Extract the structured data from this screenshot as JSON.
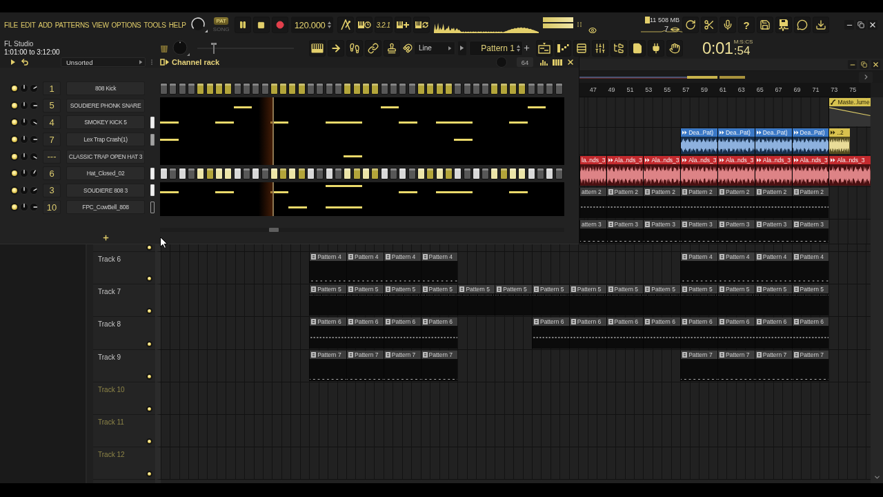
{
  "toolbar": {
    "menu": [
      "FILE",
      "EDIT",
      "ADD",
      "PATTERNS",
      "VIEW",
      "OPTIONS",
      "TOOLS",
      "HELP"
    ],
    "song_mode": [
      {
        "label": "PAT",
        "selected": true
      },
      {
        "label": "SONG",
        "selected": false
      }
    ],
    "playing": true,
    "tempo": "120.000",
    "countdown": "3.2.1",
    "output_meter": [
      {
        "level": 1
      },
      {
        "level": 1
      }
    ],
    "cpu": "11",
    "memory": "508 MB",
    "polyphony": "7",
    "help": "?",
    "title": "FL Studio",
    "hint": "1:01:00 to 3:12:00",
    "pitch": {
      "level": 0.15
    },
    "snap": "Line",
    "pattern": "Pattern 1",
    "time": "0:01",
    "time_fraction": ":54",
    "time_format": "M:S:CS"
  },
  "channel_rack": {
    "filter": "Unsorted",
    "title": "Channel rack",
    "steps_field": "64",
    "playhead": {
      "level": 0.28
    },
    "channels": [
      {
        "number": "1",
        "name": "808 Kick",
        "enabled": true,
        "pan": {
          "kind": "center"
        },
        "volume": {
          "kind": "two"
        },
        "kind": "steps",
        "steps": [
          false,
          false,
          false,
          false,
          false,
          false,
          false,
          false,
          false,
          false,
          false,
          false,
          false,
          false,
          false,
          false,
          false,
          false,
          false,
          false,
          false,
          false,
          false,
          false,
          false,
          false,
          false,
          false,
          false,
          false,
          false,
          false,
          false,
          false,
          false,
          false,
          false,
          false,
          false,
          false,
          false,
          false,
          false,
          false
        ]
      },
      {
        "number": "5",
        "name": "SOUDIERE PHONK SNARE",
        "enabled": true,
        "pan": {
          "kind": "center"
        },
        "volume": {
          "kind": "three"
        },
        "kind": "roll",
        "notes": [
          {
            "kind": "rest"
          },
          {
            "kind": "rest"
          },
          {
            "kind": "rest"
          },
          {
            "kind": "rest"
          },
          {
            "kind": "rest"
          },
          {
            "kind": "rest"
          },
          {
            "kind": "rest"
          },
          {
            "kind": "rest"
          },
          {
            "kind": "low"
          },
          {
            "kind": "low"
          },
          {
            "kind": "rest"
          },
          {
            "kind": "rest"
          },
          {
            "kind": "rest"
          },
          {
            "kind": "rest"
          },
          {
            "kind": "rest"
          },
          {
            "kind": "rest"
          },
          {
            "kind": "rest"
          },
          {
            "kind": "rest"
          },
          {
            "kind": "rest"
          },
          {
            "kind": "rest"
          },
          {
            "kind": "rest"
          },
          {
            "kind": "rest"
          },
          {
            "kind": "rest"
          },
          {
            "kind": "rest"
          },
          {
            "kind": "low"
          },
          {
            "kind": "low"
          },
          {
            "kind": "rest"
          },
          {
            "kind": "rest"
          },
          {
            "kind": "rest"
          },
          {
            "kind": "rest"
          },
          {
            "kind": "rest"
          },
          {
            "kind": "rest"
          },
          {
            "kind": "rest"
          },
          {
            "kind": "rest"
          },
          {
            "kind": "rest"
          },
          {
            "kind": "rest"
          },
          {
            "kind": "rest"
          },
          {
            "kind": "rest"
          },
          {
            "kind": "rest"
          },
          {
            "kind": "rest"
          },
          {
            "kind": "low"
          },
          {
            "kind": "low"
          },
          {
            "kind": "rest"
          },
          {
            "kind": "rest"
          }
        ]
      },
      {
        "number": "4",
        "name": "SMOKEY KICK 5",
        "enabled": true,
        "pan": {
          "kind": "center"
        },
        "volume": {
          "kind": "four"
        },
        "indicator": {
          "kind": "lit"
        },
        "kind": "roll",
        "notes": [
          {
            "kind": "note"
          },
          {
            "kind": "note"
          },
          {
            "kind": "rest"
          },
          {
            "kind": "rest"
          },
          {
            "kind": "rest"
          },
          {
            "kind": "rest"
          },
          {
            "kind": "note"
          },
          {
            "kind": "note"
          },
          {
            "kind": "rest"
          },
          {
            "kind": "rest"
          },
          {
            "kind": "rest"
          },
          {
            "kind": "rest"
          },
          {
            "kind": "note"
          },
          {
            "kind": "note"
          },
          {
            "kind": "rest"
          },
          {
            "kind": "rest"
          },
          {
            "kind": "rest"
          },
          {
            "kind": "rest"
          },
          {
            "kind": "note"
          },
          {
            "kind": "note"
          },
          {
            "kind": "note"
          },
          {
            "kind": "note"
          },
          {
            "kind": "rest"
          },
          {
            "kind": "rest"
          },
          {
            "kind": "rest"
          },
          {
            "kind": "rest"
          },
          {
            "kind": "note"
          },
          {
            "kind": "note"
          },
          {
            "kind": "rest"
          },
          {
            "kind": "rest"
          },
          {
            "kind": "note"
          },
          {
            "kind": "note"
          },
          {
            "kind": "note"
          },
          {
            "kind": "note"
          },
          {
            "kind": "rest"
          },
          {
            "kind": "rest"
          },
          {
            "kind": "rest"
          },
          {
            "kind": "rest"
          },
          {
            "kind": "note"
          },
          {
            "kind": "note"
          },
          {
            "kind": "rest"
          },
          {
            "kind": "rest"
          },
          {
            "kind": "rest"
          },
          {
            "kind": "rest"
          }
        ]
      },
      {
        "number": "7",
        "name": "Lex Trap Crash(1)",
        "enabled": true,
        "pan": {
          "kind": "center"
        },
        "volume": {
          "kind": "three"
        },
        "indicator": {
          "kind": "dim"
        },
        "kind": "roll",
        "notes": [
          {
            "kind": "note"
          },
          {
            "kind": "note"
          },
          {
            "kind": "rest"
          },
          {
            "kind": "rest"
          },
          {
            "kind": "rest"
          },
          {
            "kind": "rest"
          },
          {
            "kind": "rest"
          },
          {
            "kind": "rest"
          },
          {
            "kind": "rest"
          },
          {
            "kind": "rest"
          },
          {
            "kind": "rest"
          },
          {
            "kind": "rest"
          },
          {
            "kind": "rest"
          },
          {
            "kind": "rest"
          },
          {
            "kind": "rest"
          },
          {
            "kind": "rest"
          },
          {
            "kind": "rest"
          },
          {
            "kind": "rest"
          },
          {
            "kind": "rest"
          },
          {
            "kind": "rest"
          },
          {
            "kind": "rest"
          },
          {
            "kind": "rest"
          },
          {
            "kind": "rest"
          },
          {
            "kind": "rest"
          },
          {
            "kind": "rest"
          },
          {
            "kind": "rest"
          },
          {
            "kind": "rest"
          },
          {
            "kind": "rest"
          },
          {
            "kind": "rest"
          },
          {
            "kind": "rest"
          },
          {
            "kind": "rest"
          },
          {
            "kind": "rest"
          },
          {
            "kind": "note"
          },
          {
            "kind": "note"
          },
          {
            "kind": "rest"
          },
          {
            "kind": "rest"
          },
          {
            "kind": "rest"
          },
          {
            "kind": "rest"
          },
          {
            "kind": "rest"
          },
          {
            "kind": "rest"
          },
          {
            "kind": "rest"
          },
          {
            "kind": "rest"
          },
          {
            "kind": "rest"
          },
          {
            "kind": "rest"
          }
        ]
      },
      {
        "number": "---",
        "name": "CLASSIC TRAP OPEN HAT 3",
        "enabled": true,
        "pan": {
          "kind": "center"
        },
        "volume": {
          "kind": "four"
        },
        "kind": "roll",
        "notes": [
          {
            "kind": "rest"
          },
          {
            "kind": "rest"
          },
          {
            "kind": "rest"
          },
          {
            "kind": "rest"
          },
          {
            "kind": "rest"
          },
          {
            "kind": "rest"
          },
          {
            "kind": "rest"
          },
          {
            "kind": "rest"
          },
          {
            "kind": "rest"
          },
          {
            "kind": "rest"
          },
          {
            "kind": "rest"
          },
          {
            "kind": "rest"
          },
          {
            "kind": "rest"
          },
          {
            "kind": "rest"
          },
          {
            "kind": "rest"
          },
          {
            "kind": "rest"
          },
          {
            "kind": "rest"
          },
          {
            "kind": "rest"
          },
          {
            "kind": "rest"
          },
          {
            "kind": "rest"
          },
          {
            "kind": "note"
          },
          {
            "kind": "note"
          },
          {
            "kind": "rest"
          },
          {
            "kind": "rest"
          },
          {
            "kind": "rest"
          },
          {
            "kind": "rest"
          },
          {
            "kind": "rest"
          },
          {
            "kind": "rest"
          },
          {
            "kind": "rest"
          },
          {
            "kind": "rest"
          },
          {
            "kind": "rest"
          },
          {
            "kind": "rest"
          },
          {
            "kind": "rest"
          },
          {
            "kind": "rest"
          },
          {
            "kind": "rest"
          },
          {
            "kind": "rest"
          },
          {
            "kind": "rest"
          },
          {
            "kind": "rest"
          },
          {
            "kind": "rest"
          },
          {
            "kind": "rest"
          },
          {
            "kind": "rest"
          },
          {
            "kind": "rest"
          },
          {
            "kind": "rest"
          },
          {
            "kind": "rest"
          }
        ]
      },
      {
        "number": "6",
        "name": "Hat_Closed_02",
        "enabled": true,
        "pan": {
          "kind": "center"
        },
        "volume": {
          "kind": "one"
        },
        "indicator": {
          "kind": "lit"
        },
        "kind": "steps",
        "steps": [
          true,
          false,
          true,
          false,
          true,
          false,
          true,
          true,
          true,
          false,
          true,
          false,
          true,
          false,
          true,
          false,
          true,
          false,
          true,
          false,
          true,
          false,
          true,
          false,
          true,
          false,
          true,
          false,
          true,
          false,
          true,
          false,
          true,
          false,
          true,
          false,
          true,
          false,
          true,
          true,
          true,
          false,
          true,
          false
        ]
      },
      {
        "number": "3",
        "name": "SOUDIERE 808 3",
        "enabled": true,
        "pan": {
          "kind": "center"
        },
        "volume": {
          "kind": "two"
        },
        "indicator": {
          "kind": "lit"
        },
        "kind": "roll",
        "notes": [
          {
            "kind": "low"
          },
          {
            "kind": "low"
          },
          {
            "kind": "rest"
          },
          {
            "kind": "rest"
          },
          {
            "kind": "rest"
          },
          {
            "kind": "rest"
          },
          {
            "kind": "low"
          },
          {
            "kind": "low"
          },
          {
            "kind": "rest"
          },
          {
            "kind": "rest"
          },
          {
            "kind": "rest"
          },
          {
            "kind": "rest"
          },
          {
            "kind": "low"
          },
          {
            "kind": "low"
          },
          {
            "kind": "rest"
          },
          {
            "kind": "rest"
          },
          {
            "kind": "rest"
          },
          {
            "kind": "rest"
          },
          {
            "kind": "high"
          },
          {
            "kind": "high"
          },
          {
            "kind": "high"
          },
          {
            "kind": "high"
          },
          {
            "kind": "rest"
          },
          {
            "kind": "rest"
          },
          {
            "kind": "rest"
          },
          {
            "kind": "rest"
          },
          {
            "kind": "low"
          },
          {
            "kind": "low"
          },
          {
            "kind": "rest"
          },
          {
            "kind": "rest"
          },
          {
            "kind": "low"
          },
          {
            "kind": "low"
          },
          {
            "kind": "low"
          },
          {
            "kind": "low"
          },
          {
            "kind": "rest"
          },
          {
            "kind": "rest"
          },
          {
            "kind": "rest"
          },
          {
            "kind": "rest"
          },
          {
            "kind": "low"
          },
          {
            "kind": "low"
          },
          {
            "kind": "rest"
          },
          {
            "kind": "rest"
          },
          {
            "kind": "rest"
          },
          {
            "kind": "rest"
          }
        ]
      },
      {
        "number": "10",
        "name": "FPC_CowBell_808",
        "enabled": true,
        "pan": {
          "kind": "center"
        },
        "volume": {
          "kind": "three"
        },
        "indicator": {
          "kind": "outline"
        },
        "kind": "roll",
        "notes": [
          {
            "kind": "rest"
          },
          {
            "kind": "rest"
          },
          {
            "kind": "rest"
          },
          {
            "kind": "rest"
          },
          {
            "kind": "rest"
          },
          {
            "kind": "rest"
          },
          {
            "kind": "rest"
          },
          {
            "kind": "rest"
          },
          {
            "kind": "rest"
          },
          {
            "kind": "rest"
          },
          {
            "kind": "rest"
          },
          {
            "kind": "rest"
          },
          {
            "kind": "rest"
          },
          {
            "kind": "rest"
          },
          {
            "kind": "note"
          },
          {
            "kind": "note"
          },
          {
            "kind": "rest"
          },
          {
            "kind": "rest"
          },
          {
            "kind": "note"
          },
          {
            "kind": "note"
          },
          {
            "kind": "note"
          },
          {
            "kind": "note"
          },
          {
            "kind": "rest"
          },
          {
            "kind": "rest"
          },
          {
            "kind": "rest"
          },
          {
            "kind": "rest"
          },
          {
            "kind": "rest"
          },
          {
            "kind": "rest"
          },
          {
            "kind": "rest"
          },
          {
            "kind": "rest"
          },
          {
            "kind": "rest"
          },
          {
            "kind": "rest"
          },
          {
            "kind": "rest"
          },
          {
            "kind": "rest"
          },
          {
            "kind": "rest"
          },
          {
            "kind": "rest"
          },
          {
            "kind": "rest"
          },
          {
            "kind": "rest"
          },
          {
            "kind": "rest"
          },
          {
            "kind": "rest"
          },
          {
            "kind": "rest"
          },
          {
            "kind": "rest"
          },
          {
            "kind": "rest"
          },
          {
            "kind": "rest"
          }
        ]
      }
    ]
  },
  "playlist": {
    "ruler": [
      "47",
      "49",
      "51",
      "53",
      "55",
      "57",
      "59",
      "61",
      "63",
      "65",
      "67",
      "69",
      "71",
      "73",
      "75"
    ],
    "tracks": [
      {
        "clips": [
          {
            "kind": "gap"
          },
          {
            "kind": "gap"
          },
          {
            "kind": "gap"
          },
          {
            "kind": "gap"
          },
          {
            "kind": "gap"
          },
          {
            "kind": "gap"
          },
          {
            "kind": "gap"
          },
          {
            "kind": "automation",
            "name": "Maste..lume"
          }
        ]
      },
      {
        "clips": [
          {
            "kind": "gap"
          },
          {
            "kind": "gap"
          },
          {
            "kind": "gap"
          },
          {
            "kind": "audio",
            "name": "Dea..Pat)",
            "color": "#3a78c6"
          },
          {
            "kind": "audio",
            "name": "Dea..Pat)",
            "color": "#3a78c6"
          },
          {
            "kind": "audio",
            "name": "Dea..Pat)",
            "color": "#3a78c6"
          },
          {
            "kind": "audio",
            "name": "Dea..Pat)",
            "color": "#3a78c6"
          },
          {
            "kind": "snippet",
            "name": "..2",
            "color": "#d9c24e"
          }
        ]
      },
      {
        "clips": [
          {
            "kind": "audio",
            "name": "la..nds_3",
            "color": "#c42a2e"
          },
          {
            "kind": "audio",
            "name": "Ala..nds_3",
            "color": "#c42a2e"
          },
          {
            "kind": "audio",
            "name": "Ala..nds_3",
            "color": "#c42a2e"
          },
          {
            "kind": "audio",
            "name": "Ala..nds_3",
            "color": "#c42a2e"
          },
          {
            "kind": "audio",
            "name": "Ala..nds_3",
            "color": "#c42a2e"
          },
          {
            "kind": "audio",
            "name": "Ala..nds_3",
            "color": "#c42a2e"
          },
          {
            "kind": "audio",
            "name": "Ala..nds_3",
            "color": "#c42a2e"
          },
          {
            "kind": "audio",
            "name": "Ala..nds_3",
            "color": "#c42a2e"
          }
        ]
      },
      {
        "clips": [
          {
            "kind": "pattern",
            "name": "attern 2"
          },
          {
            "kind": "pattern",
            "name": "Pattern 2"
          },
          {
            "kind": "pattern",
            "name": "Pattern 2"
          },
          {
            "kind": "pattern",
            "name": "Pattern 2"
          },
          {
            "kind": "pattern",
            "name": "Pattern 2"
          },
          {
            "kind": "pattern",
            "name": "Pattern 2"
          },
          {
            "kind": "pattern",
            "name": "Pattern 2"
          }
        ]
      },
      {
        "enabled": true,
        "clips": [
          {
            "kind": "pattern",
            "name": "attern 3"
          },
          {
            "kind": "pattern",
            "name": "Pattern 3"
          },
          {
            "kind": "pattern",
            "name": "Pattern 3"
          },
          {
            "kind": "pattern",
            "name": "Pattern 3"
          },
          {
            "kind": "pattern",
            "name": "Pattern 3"
          },
          {
            "kind": "pattern",
            "name": "Pattern 3"
          },
          {
            "kind": "pattern",
            "name": "Pattern 3"
          }
        ]
      },
      {
        "name": "Track 6",
        "enabled": true,
        "clips": [
          {
            "kind": "gap"
          },
          {
            "kind": "gap"
          },
          {
            "kind": "gap"
          },
          {
            "kind": "gap"
          },
          {
            "kind": "pattern",
            "name": "Pattern 4"
          },
          {
            "kind": "pattern",
            "name": "Pattern 4"
          },
          {
            "kind": "pattern",
            "name": "Pattern 4"
          },
          {
            "kind": "pattern",
            "name": "Pattern 4"
          },
          {
            "kind": "gap"
          },
          {
            "kind": "gap"
          },
          {
            "kind": "gap"
          },
          {
            "kind": "gap"
          },
          {
            "kind": "gap"
          },
          {
            "kind": "gap"
          },
          {
            "kind": "pattern",
            "name": "Pattern 4"
          },
          {
            "kind": "pattern",
            "name": "Pattern 4"
          },
          {
            "kind": "pattern",
            "name": "Pattern 4"
          },
          {
            "kind": "pattern",
            "name": "Pattern 4"
          }
        ]
      },
      {
        "name": "Track 7",
        "enabled": true,
        "clips": [
          {
            "kind": "gap"
          },
          {
            "kind": "gap"
          },
          {
            "kind": "gap"
          },
          {
            "kind": "gap"
          },
          {
            "kind": "pattern",
            "name": "Pattern 5"
          },
          {
            "kind": "pattern",
            "name": "Pattern 5"
          },
          {
            "kind": "pattern",
            "name": "Pattern 5"
          },
          {
            "kind": "pattern",
            "name": "Pattern 5"
          },
          {
            "kind": "pattern",
            "name": "Pattern 5"
          },
          {
            "kind": "pattern",
            "name": "Pattern 5"
          },
          {
            "kind": "pattern",
            "name": "Pattern 5"
          },
          {
            "kind": "pattern",
            "name": "Pattern 5"
          },
          {
            "kind": "pattern",
            "name": "Pattern 5"
          },
          {
            "kind": "pattern",
            "name": "Pattern 5"
          },
          {
            "kind": "pattern",
            "name": "Pattern 5"
          },
          {
            "kind": "pattern",
            "name": "Pattern 5"
          },
          {
            "kind": "pattern",
            "name": "Pattern 5"
          },
          {
            "kind": "pattern",
            "name": "Pattern 5"
          }
        ]
      },
      {
        "name": "Track 8",
        "enabled": true,
        "clips": [
          {
            "kind": "gap"
          },
          {
            "kind": "gap"
          },
          {
            "kind": "gap"
          },
          {
            "kind": "gap"
          },
          {
            "kind": "pattern",
            "name": "Pattern 6"
          },
          {
            "kind": "pattern",
            "name": "Pattern 6"
          },
          {
            "kind": "pattern",
            "name": "Pattern 6"
          },
          {
            "kind": "pattern",
            "name": "Pattern 6"
          },
          {
            "kind": "gap"
          },
          {
            "kind": "gap"
          },
          {
            "kind": "pattern",
            "name": "Pattern 6"
          },
          {
            "kind": "pattern",
            "name": "Pattern 6"
          },
          {
            "kind": "pattern",
            "name": "Pattern 6"
          },
          {
            "kind": "pattern",
            "name": "Pattern 6"
          },
          {
            "kind": "pattern",
            "name": "Pattern 6"
          },
          {
            "kind": "pattern",
            "name": "Pattern 6"
          },
          {
            "kind": "pattern",
            "name": "Pattern 6"
          },
          {
            "kind": "pattern",
            "name": "Pattern 6"
          }
        ]
      },
      {
        "name": "Track 9",
        "enabled": true,
        "clips": [
          {
            "kind": "gap"
          },
          {
            "kind": "gap"
          },
          {
            "kind": "gap"
          },
          {
            "kind": "gap"
          },
          {
            "kind": "pattern",
            "name": "Pattern 7"
          },
          {
            "kind": "pattern",
            "name": "Pattern 7"
          },
          {
            "kind": "pattern",
            "name": "Pattern 7"
          },
          {
            "kind": "pattern",
            "name": "Pattern 7"
          },
          {
            "kind": "gap"
          },
          {
            "kind": "gap"
          },
          {
            "kind": "gap"
          },
          {
            "kind": "gap"
          },
          {
            "kind": "gap"
          },
          {
            "kind": "gap"
          },
          {
            "kind": "pattern",
            "name": "Pattern 7"
          },
          {
            "kind": "pattern",
            "name": "Pattern 7"
          },
          {
            "kind": "pattern",
            "name": "Pattern 7"
          },
          {
            "kind": "pattern",
            "name": "Pattern 7"
          }
        ]
      },
      {
        "name": "Track 10",
        "enabled": true
      },
      {
        "name": "Track 11",
        "enabled": true
      },
      {
        "name": "Track 12",
        "enabled": true
      }
    ]
  }
}
